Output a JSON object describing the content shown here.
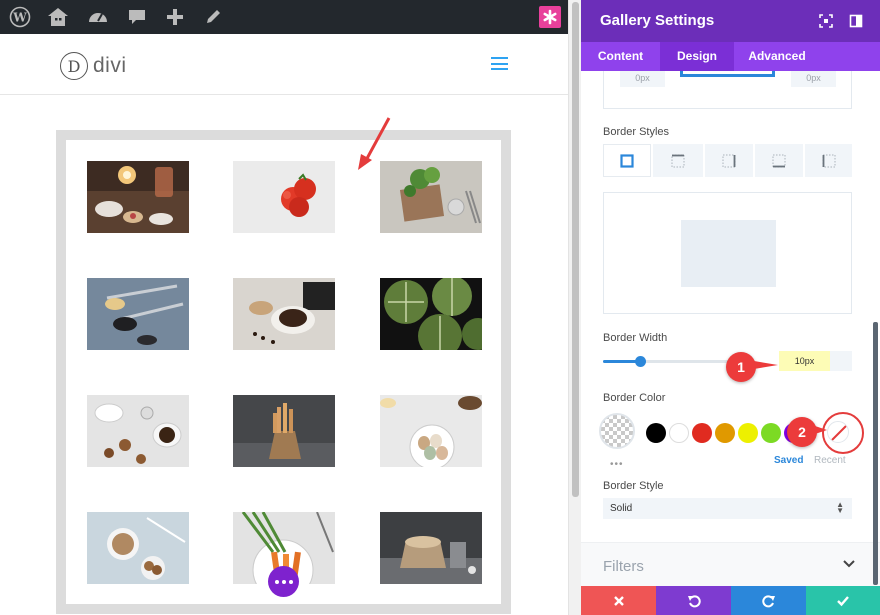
{
  "admin_bar": {
    "icons": [
      "wordpress-logo-icon",
      "my-sites-icon",
      "dashboard-icon",
      "comments-icon",
      "new-content-icon",
      "edit-icon",
      "divi-builder-icon"
    ]
  },
  "site": {
    "logo_letter": "D",
    "logo_text": "divi",
    "menu_icon": "hamburger-icon",
    "accent_color": "#2ea3f2"
  },
  "gallery": {
    "border_color": "#dcdcdc",
    "thumbnails": [
      "candle-sweets-table",
      "red-tomatoes",
      "herbs-board",
      "spoons-seeds",
      "coffee-cup-beans",
      "green-pumpkins",
      "coffee-beans-cookies",
      "bread-sticks-bag",
      "eggs-bowl",
      "coffee-cookies-plate",
      "carrots-bunch",
      "bread-basket"
    ]
  },
  "panel": {
    "title": "Gallery Settings",
    "header_color": "#6c2eb9",
    "tabs": [
      {
        "label": "Content",
        "active": false
      },
      {
        "label": "Design",
        "active": true
      },
      {
        "label": "Advanced",
        "active": false
      }
    ],
    "radius_left_value": "0px",
    "radius_right_value": "0px",
    "border_styles_label": "Border Styles",
    "border_style_tabs": [
      "all-sides",
      "top-side",
      "right-side",
      "bottom-side",
      "left-side"
    ],
    "border_width_label": "Border Width",
    "border_width_value": "10px",
    "border_width_slider": 0.23,
    "border_color_label": "Border Color",
    "swatches": [
      "#000000",
      "#ffffff",
      "#e02b20",
      "#e09900",
      "#edf000",
      "#7cda24",
      "#8300e9"
    ],
    "more_colors": "•••",
    "saved_label": "Saved",
    "recent_label": "Recent",
    "border_style_label": "Border Style",
    "border_style_value": "Solid",
    "filters_label": "Filters",
    "footer": [
      {
        "action": "discard",
        "icon": "close-icon",
        "color": "#ef5555"
      },
      {
        "action": "undo",
        "icon": "undo-icon",
        "color": "#7e3bd0"
      },
      {
        "action": "redo",
        "icon": "redo-icon",
        "color": "#2b87da"
      },
      {
        "action": "save",
        "icon": "check-icon",
        "color": "#29c4a9"
      }
    ]
  },
  "annotations": [
    {
      "number": "1",
      "color": "#ec3b3b"
    },
    {
      "number": "2",
      "color": "#ec3b3b"
    }
  ]
}
